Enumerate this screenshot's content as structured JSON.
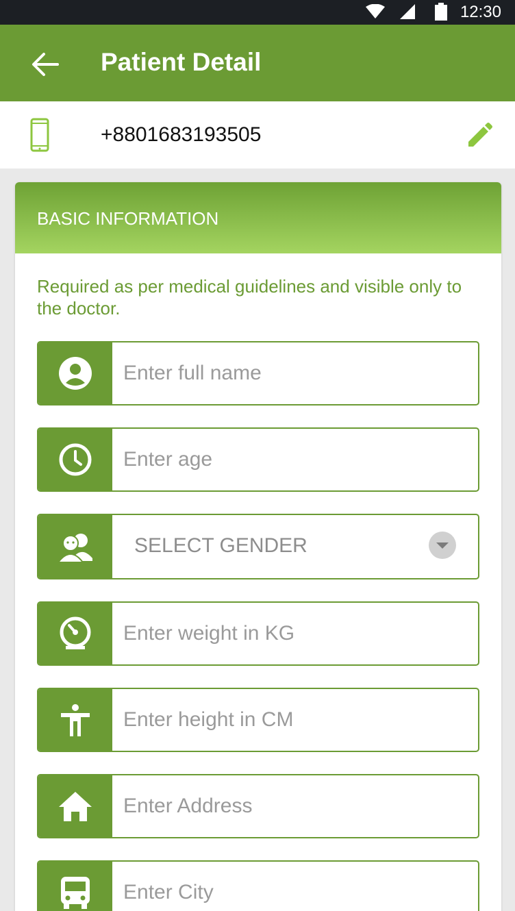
{
  "status_bar": {
    "time": "12:30"
  },
  "app_bar": {
    "title": "Patient Detail",
    "back_icon": "arrow-left-icon"
  },
  "phone": {
    "number": "+8801683193505",
    "icon": "smartphone-icon",
    "edit_icon": "pencil-icon"
  },
  "basic_info": {
    "header": "BASIC INFORMATION",
    "note": "Required as per medical guidelines and visible only to the doctor.",
    "fields": {
      "name": {
        "placeholder": "Enter full name",
        "icon": "user-circle-icon"
      },
      "age": {
        "placeholder": "Enter age",
        "icon": "clock-icon"
      },
      "gender": {
        "label": "SELECT GENDER",
        "icon": "people-icon"
      },
      "weight": {
        "placeholder": "Enter weight in KG",
        "icon": "scale-icon"
      },
      "height": {
        "placeholder": "Enter height in CM",
        "icon": "person-standing-icon"
      },
      "address": {
        "placeholder": "Enter Address",
        "icon": "home-icon"
      },
      "city": {
        "placeholder": "Enter City",
        "icon": "bus-icon"
      }
    }
  },
  "colors": {
    "primary": "#6b9b34",
    "header_light": "#a4d460",
    "accent": "#8dc63f"
  }
}
